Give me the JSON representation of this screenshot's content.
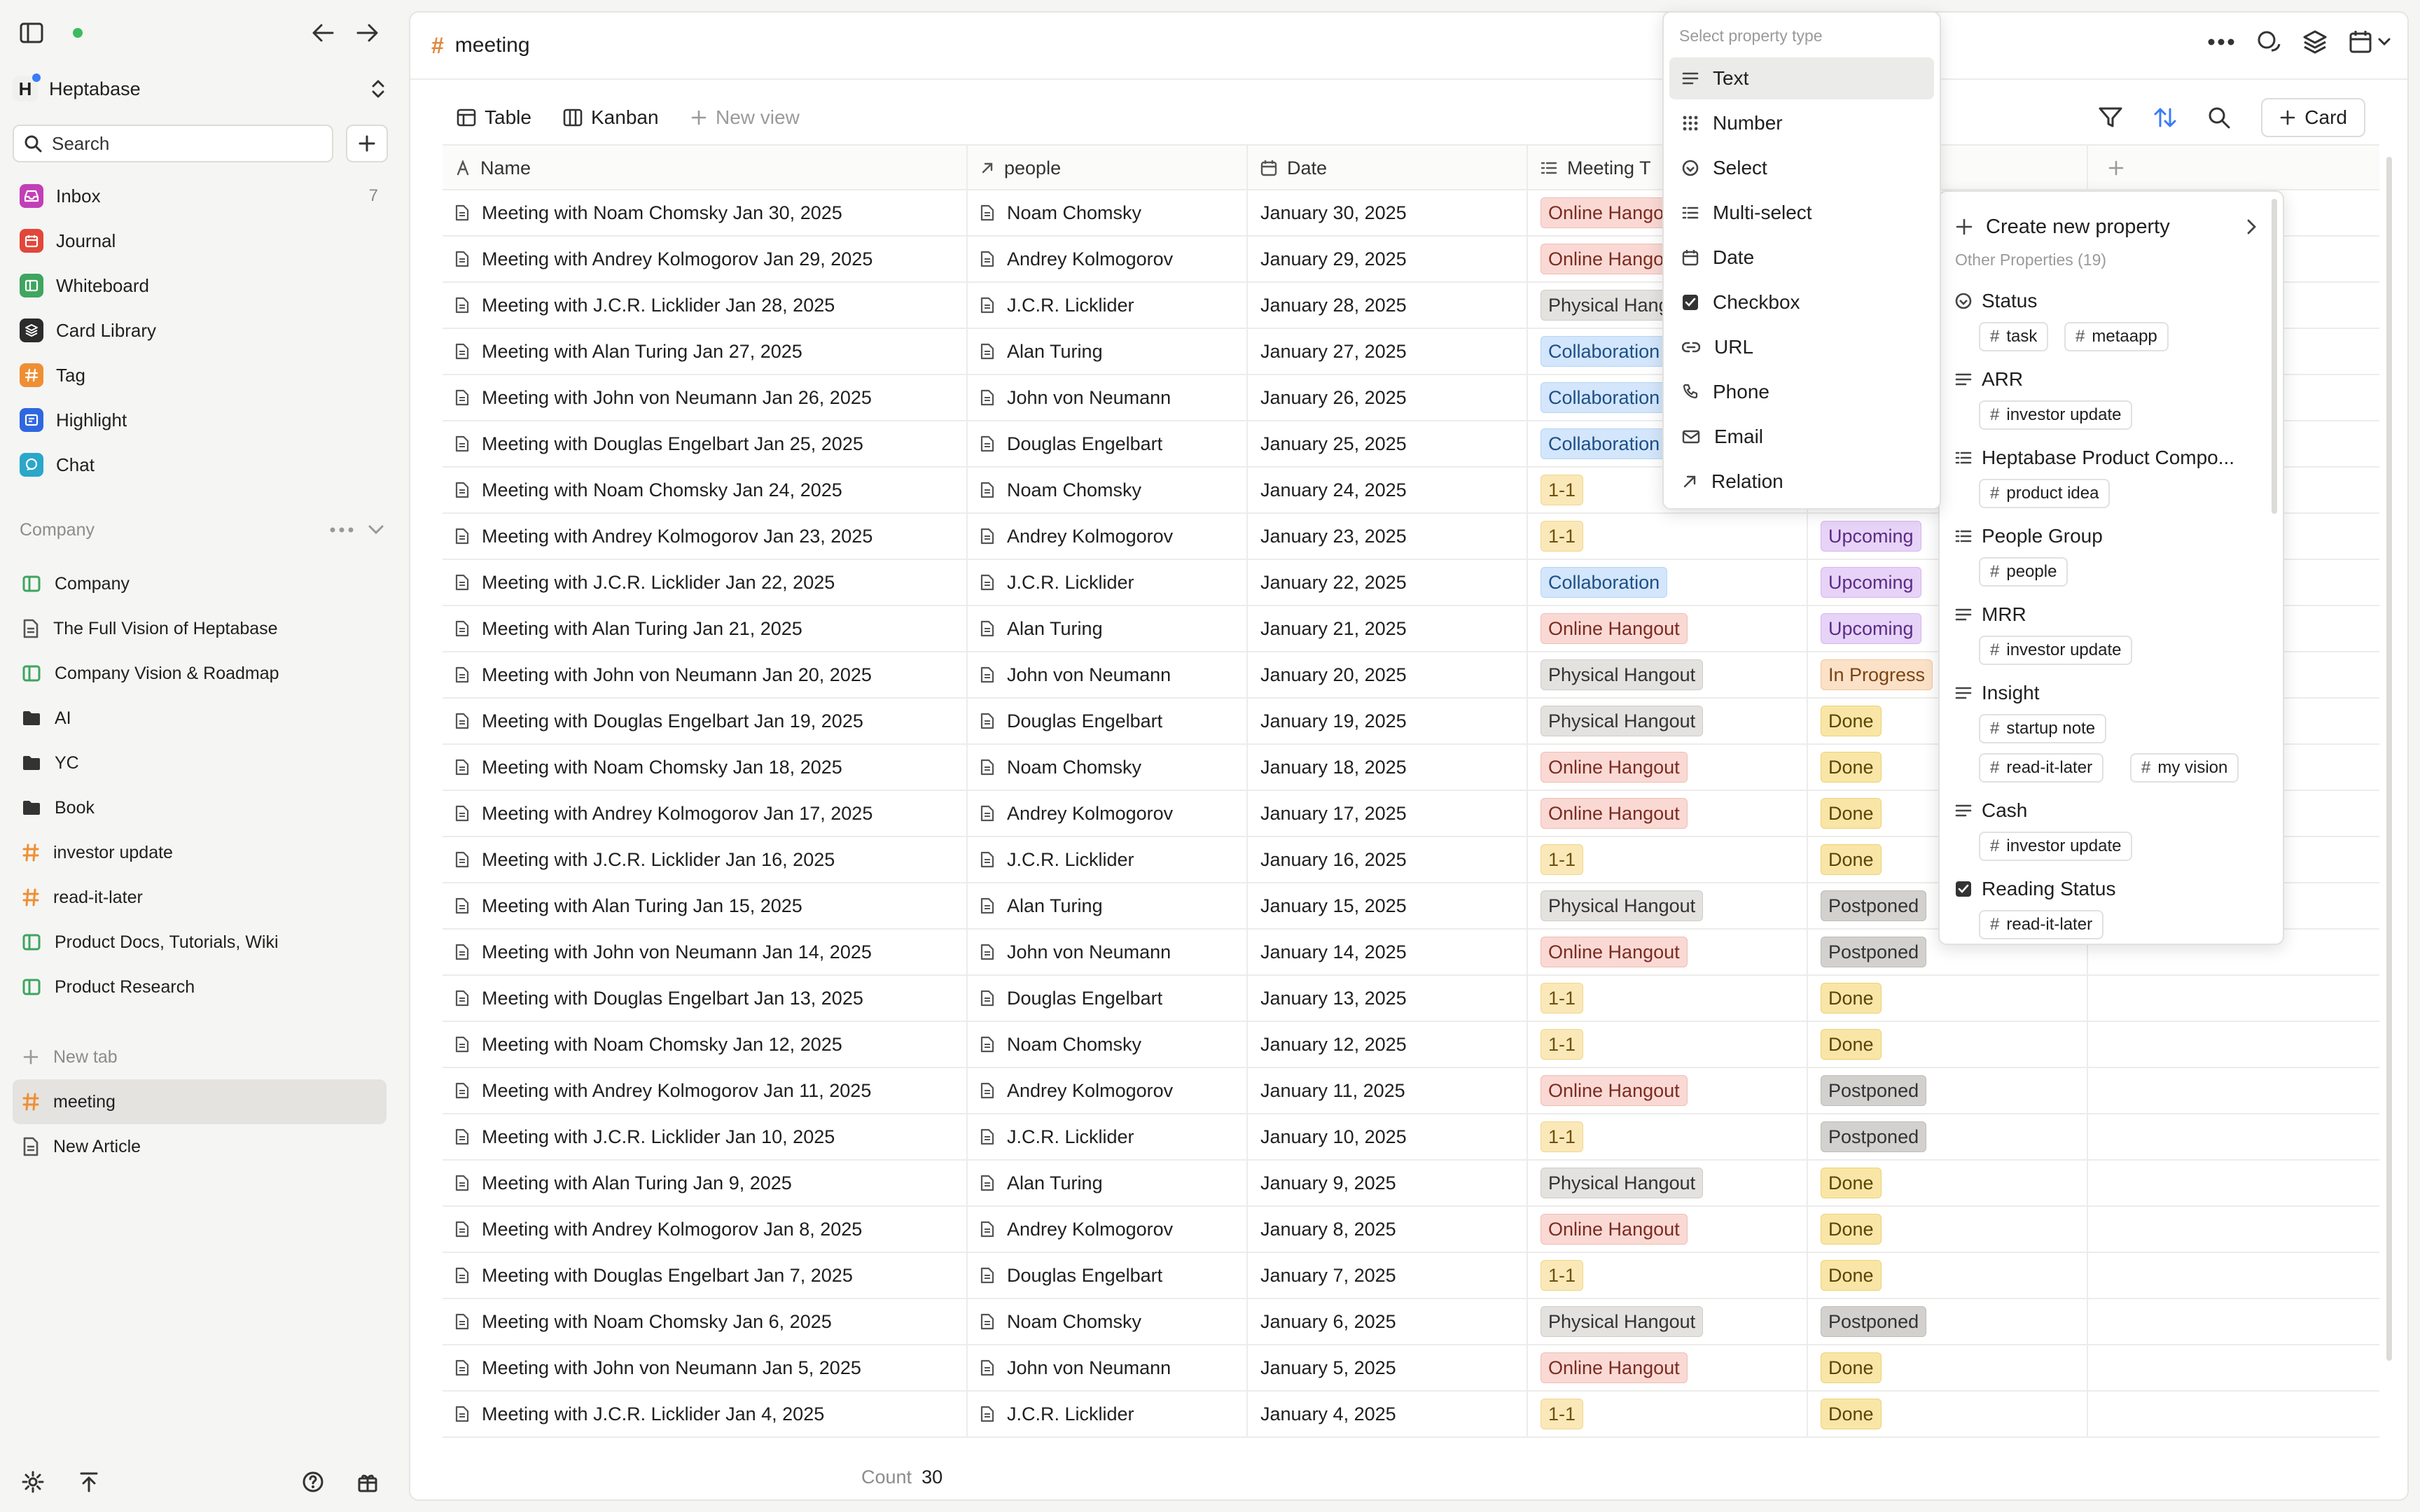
{
  "sidebar": {
    "workspace": {
      "initial": "H",
      "name": "Heptabase"
    },
    "search": {
      "label": "Search"
    },
    "nav": [
      {
        "label": "Inbox",
        "count": "7",
        "color": "#c23fb7",
        "icon": "inbox-icon"
      },
      {
        "label": "Journal",
        "count": "",
        "color": "#e2473a",
        "icon": "journal-icon"
      },
      {
        "label": "Whiteboard",
        "count": "",
        "color": "#3fa55f",
        "icon": "whiteboard-icon"
      },
      {
        "label": "Card Library",
        "count": "",
        "color": "#2c2c2c",
        "icon": "card-library-icon"
      },
      {
        "label": "Tag",
        "count": "",
        "color": "#ef8f34",
        "icon": "tag-icon"
      },
      {
        "label": "Highlight",
        "count": "",
        "color": "#2f67e0",
        "icon": "highlight-icon"
      },
      {
        "label": "Chat",
        "count": "",
        "color": "#2aa7c9",
        "icon": "chat-icon"
      }
    ],
    "section": {
      "label": "Company"
    },
    "tree": [
      {
        "label": "Company",
        "icon": "whiteboard"
      },
      {
        "label": "The Full Vision of Heptabase",
        "icon": "doc"
      },
      {
        "label": "Company Vision & Roadmap",
        "icon": "whiteboard"
      },
      {
        "label": "AI",
        "icon": "folder"
      },
      {
        "label": "YC",
        "icon": "folder"
      },
      {
        "label": "Book",
        "icon": "folder"
      },
      {
        "label": "investor update",
        "icon": "hash"
      },
      {
        "label": "read-it-later",
        "icon": "hash"
      },
      {
        "label": "Product Docs, Tutorials, Wiki",
        "icon": "whiteboard"
      },
      {
        "label": "Product Research",
        "icon": "whiteboard"
      }
    ],
    "tabs": {
      "new_tab": "New tab",
      "items": [
        {
          "label": "meeting",
          "icon": "hash",
          "active": true
        },
        {
          "label": "New Article",
          "icon": "doc",
          "active": false
        }
      ]
    }
  },
  "main": {
    "title": "meeting",
    "views": {
      "table": "Table",
      "kanban": "Kanban",
      "new_view": "New view"
    },
    "card_button": "Card",
    "columns": [
      "Name",
      "people",
      "Date",
      "Meeting T",
      ""
    ],
    "rows": [
      {
        "name": "Meeting with Noam Chomsky Jan 30, 2025",
        "person": "Noam Chomsky",
        "date": "January 30, 2025",
        "type": "Online Hangout",
        "status": ""
      },
      {
        "name": "Meeting with Andrey Kolmogorov Jan 29, 2025",
        "person": "Andrey Kolmogorov",
        "date": "January 29, 2025",
        "type": "Online Hangout",
        "status": ""
      },
      {
        "name": "Meeting with J.C.R. Licklider Jan 28, 2025",
        "person": "J.C.R. Licklider",
        "date": "January 28, 2025",
        "type": "Physical Hangout",
        "status": ""
      },
      {
        "name": "Meeting with Alan Turing Jan 27, 2025",
        "person": "Alan Turing",
        "date": "January 27, 2025",
        "type": "Collaboration",
        "status": ""
      },
      {
        "name": "Meeting with John von Neumann Jan 26, 2025",
        "person": "John von Neumann",
        "date": "January 26, 2025",
        "type": "Collaboration",
        "status": ""
      },
      {
        "name": "Meeting with Douglas Engelbart Jan 25, 2025",
        "person": "Douglas Engelbart",
        "date": "January 25, 2025",
        "type": "Collaboration",
        "status": ""
      },
      {
        "name": "Meeting with Noam Chomsky Jan 24, 2025",
        "person": "Noam Chomsky",
        "date": "January 24, 2025",
        "type": "1-1",
        "status": ""
      },
      {
        "name": "Meeting with Andrey Kolmogorov Jan 23, 2025",
        "person": "Andrey Kolmogorov",
        "date": "January 23, 2025",
        "type": "1-1",
        "status": "Upcoming"
      },
      {
        "name": "Meeting with J.C.R. Licklider Jan 22, 2025",
        "person": "J.C.R. Licklider",
        "date": "January 22, 2025",
        "type": "Collaboration",
        "status": "Upcoming"
      },
      {
        "name": "Meeting with Alan Turing Jan 21, 2025",
        "person": "Alan Turing",
        "date": "January 21, 2025",
        "type": "Online Hangout",
        "status": "Upcoming"
      },
      {
        "name": "Meeting with John von Neumann Jan 20, 2025",
        "person": "John von Neumann",
        "date": "January 20, 2025",
        "type": "Physical Hangout",
        "status": "In Progress"
      },
      {
        "name": "Meeting with Douglas Engelbart Jan 19, 2025",
        "person": "Douglas Engelbart",
        "date": "January 19, 2025",
        "type": "Physical Hangout",
        "status": "Done"
      },
      {
        "name": "Meeting with Noam Chomsky Jan 18, 2025",
        "person": "Noam Chomsky",
        "date": "January 18, 2025",
        "type": "Online Hangout",
        "status": "Done"
      },
      {
        "name": "Meeting with Andrey Kolmogorov Jan 17, 2025",
        "person": "Andrey Kolmogorov",
        "date": "January 17, 2025",
        "type": "Online Hangout",
        "status": "Done"
      },
      {
        "name": "Meeting with J.C.R. Licklider Jan 16, 2025",
        "person": "J.C.R. Licklider",
        "date": "January 16, 2025",
        "type": "1-1",
        "status": "Done"
      },
      {
        "name": "Meeting with Alan Turing Jan 15, 2025",
        "person": "Alan Turing",
        "date": "January 15, 2025",
        "type": "Physical Hangout",
        "status": "Postponed"
      },
      {
        "name": "Meeting with John von Neumann Jan 14, 2025",
        "person": "John von Neumann",
        "date": "January 14, 2025",
        "type": "Online Hangout",
        "status": "Postponed"
      },
      {
        "name": "Meeting with Douglas Engelbart Jan 13, 2025",
        "person": "Douglas Engelbart",
        "date": "January 13, 2025",
        "type": "1-1",
        "status": "Done"
      },
      {
        "name": "Meeting with Noam Chomsky Jan 12, 2025",
        "person": "Noam Chomsky",
        "date": "January 12, 2025",
        "type": "1-1",
        "status": "Done"
      },
      {
        "name": "Meeting with Andrey Kolmogorov Jan 11, 2025",
        "person": "Andrey Kolmogorov",
        "date": "January 11, 2025",
        "type": "Online Hangout",
        "status": "Postponed"
      },
      {
        "name": "Meeting with J.C.R. Licklider Jan 10, 2025",
        "person": "J.C.R. Licklider",
        "date": "January 10, 2025",
        "type": "1-1",
        "status": "Postponed"
      },
      {
        "name": "Meeting with Alan Turing Jan 9, 2025",
        "person": "Alan Turing",
        "date": "January 9, 2025",
        "type": "Physical Hangout",
        "status": "Done"
      },
      {
        "name": "Meeting with Andrey Kolmogorov Jan 8, 2025",
        "person": "Andrey Kolmogorov",
        "date": "January 8, 2025",
        "type": "Online Hangout",
        "status": "Done"
      },
      {
        "name": "Meeting with Douglas Engelbart Jan 7, 2025",
        "person": "Douglas Engelbart",
        "date": "January 7, 2025",
        "type": "1-1",
        "status": "Done"
      },
      {
        "name": "Meeting with Noam Chomsky Jan 6, 2025",
        "person": "Noam Chomsky",
        "date": "January 6, 2025",
        "type": "Physical Hangout",
        "status": "Postponed"
      },
      {
        "name": "Meeting with John von Neumann Jan 5, 2025",
        "person": "John von Neumann",
        "date": "January 5, 2025",
        "type": "Online Hangout",
        "status": "Done"
      },
      {
        "name": "Meeting with J.C.R. Licklider Jan 4, 2025",
        "person": "J.C.R. Licklider",
        "date": "January 4, 2025",
        "type": "1-1",
        "status": "Done"
      }
    ],
    "footer": {
      "count_label": "Count",
      "count_value": "30"
    }
  },
  "type_menu": {
    "header": "Select property type",
    "items": [
      {
        "label": "Text",
        "icon": "text-icon",
        "selected": true
      },
      {
        "label": "Number",
        "icon": "number-icon",
        "selected": false
      },
      {
        "label": "Select",
        "icon": "select-icon",
        "selected": false
      },
      {
        "label": "Multi-select",
        "icon": "multi-select-icon",
        "selected": false
      },
      {
        "label": "Date",
        "icon": "date-icon",
        "selected": false
      },
      {
        "label": "Checkbox",
        "icon": "checkbox-icon",
        "selected": false
      },
      {
        "label": "URL",
        "icon": "url-icon",
        "selected": false
      },
      {
        "label": "Phone",
        "icon": "phone-icon",
        "selected": false
      },
      {
        "label": "Email",
        "icon": "email-icon",
        "selected": false
      },
      {
        "label": "Relation",
        "icon": "relation-icon",
        "selected": false
      }
    ]
  },
  "prop_menu": {
    "create": "Create new property",
    "other": "Other Properties (19)",
    "props": [
      {
        "label": "Status",
        "icon": "select",
        "tags": [
          "task",
          "metaapp"
        ]
      },
      {
        "label": "ARR",
        "icon": "text",
        "tags": [
          "investor update"
        ]
      },
      {
        "label": "Heptabase Product Compo...",
        "icon": "multi",
        "tags": [
          "product idea"
        ]
      },
      {
        "label": "People Group",
        "icon": "multi",
        "tags": [
          "people"
        ]
      },
      {
        "label": "MRR",
        "icon": "text",
        "tags": [
          "investor update"
        ]
      },
      {
        "label": "Insight",
        "icon": "text",
        "tags": [
          "startup note",
          "read-it-later",
          "my vision"
        ]
      },
      {
        "label": "Cash",
        "icon": "text",
        "tags": [
          "investor update"
        ]
      },
      {
        "label": "Reading Status",
        "icon": "checkbox",
        "tags": [
          "read-it-later"
        ]
      }
    ]
  }
}
